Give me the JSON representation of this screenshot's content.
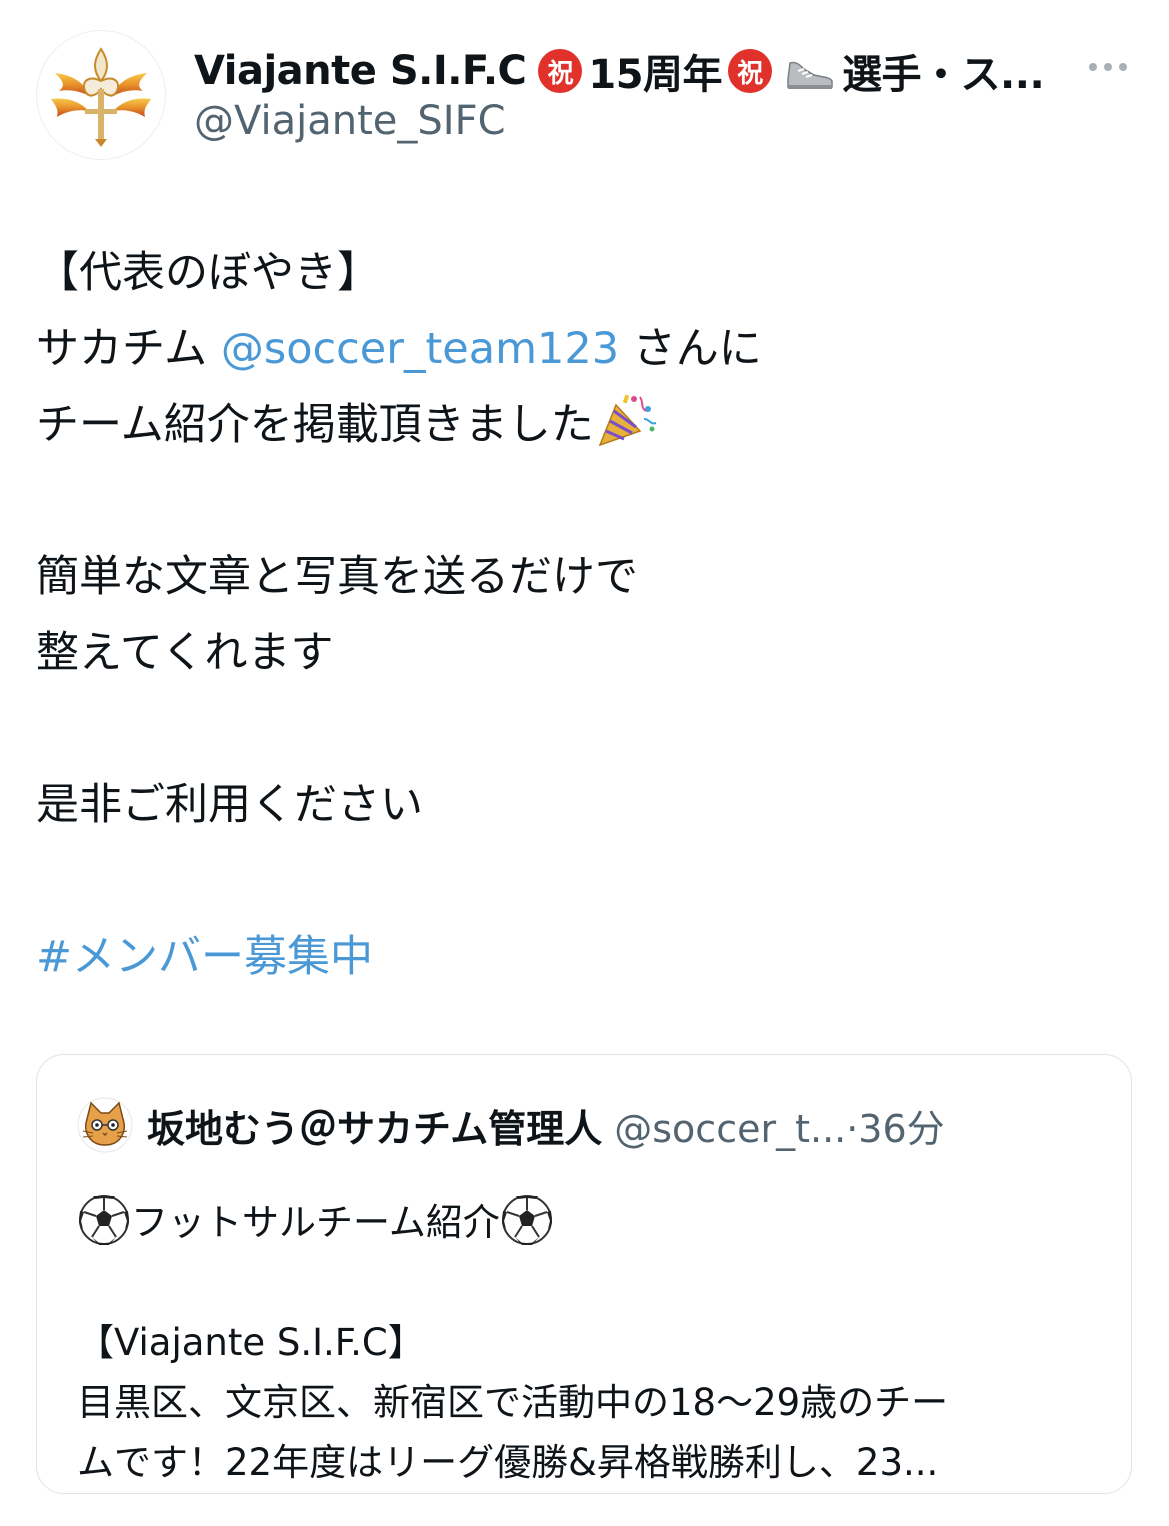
{
  "author": {
    "display_name_parts": [
      "Viajante S.I.F.C",
      "15周年",
      "選手・ス..."
    ],
    "celebration_badge": "祝",
    "handle": "@Viajante_SIFC",
    "avatar_icon": "fleur-de-lis-crest-icon"
  },
  "tweet": {
    "heading": "【代表のぼやき】",
    "line2_prefix": "サカチム ",
    "line2_mention": "@soccer_team123",
    "line2_suffix": " さんに",
    "line3": "チーム紹介を掲載頂きました",
    "line3_icon": "party-popper-icon",
    "line4": "簡単な文章と写真を送るだけで",
    "line5": "整えてくれます",
    "line6": "是非ご利用ください",
    "hashtag": "#メンバー募集中"
  },
  "quote": {
    "name": "坂地むう＠サカチム管理人",
    "handle_time": "@soccer_t...·36分",
    "avatar_icon": "cat-face-icon",
    "title": "フットサルチーム紹介",
    "title_icon": "soccer-ball-icon",
    "team": "【Viajante S.I.F.C】",
    "desc1": "目黒区、文京区、新宿区で活動中の18〜29歳のチー",
    "desc2": "ムです！22年度はリーグ優勝&昇格戦勝利し、23..."
  },
  "colors": {
    "link": "#4a99d6",
    "secondary_text": "#536471",
    "badge_red": "#e0312b",
    "card_border": "#dfe3e7"
  }
}
